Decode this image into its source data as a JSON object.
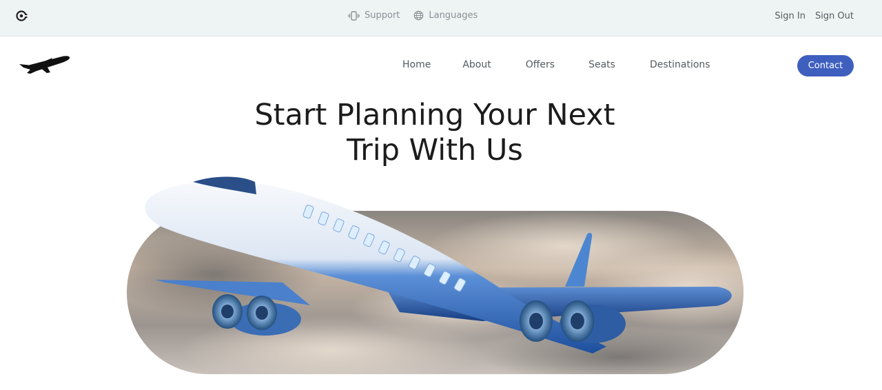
{
  "topbar": {
    "logo_icon": "concentric-logo-icon",
    "support": {
      "label": "Support",
      "icon": "vibrate-phone-icon"
    },
    "languages": {
      "label": "Languages",
      "icon": "globe-icon"
    },
    "sign_in": "Sign In",
    "sign_out": "Sign Out"
  },
  "header": {
    "brand_icon": "airplane-icon",
    "nav": [
      "Home",
      "About",
      "Offers",
      "Seats",
      "Destinations"
    ],
    "contact": "Contact",
    "colors": {
      "contact_bg": "#3f5fbf"
    }
  },
  "hero": {
    "title_line1": "Start Planning Your Next",
    "title_line2": "Trip With Us",
    "image": "airplane-over-clouds"
  }
}
